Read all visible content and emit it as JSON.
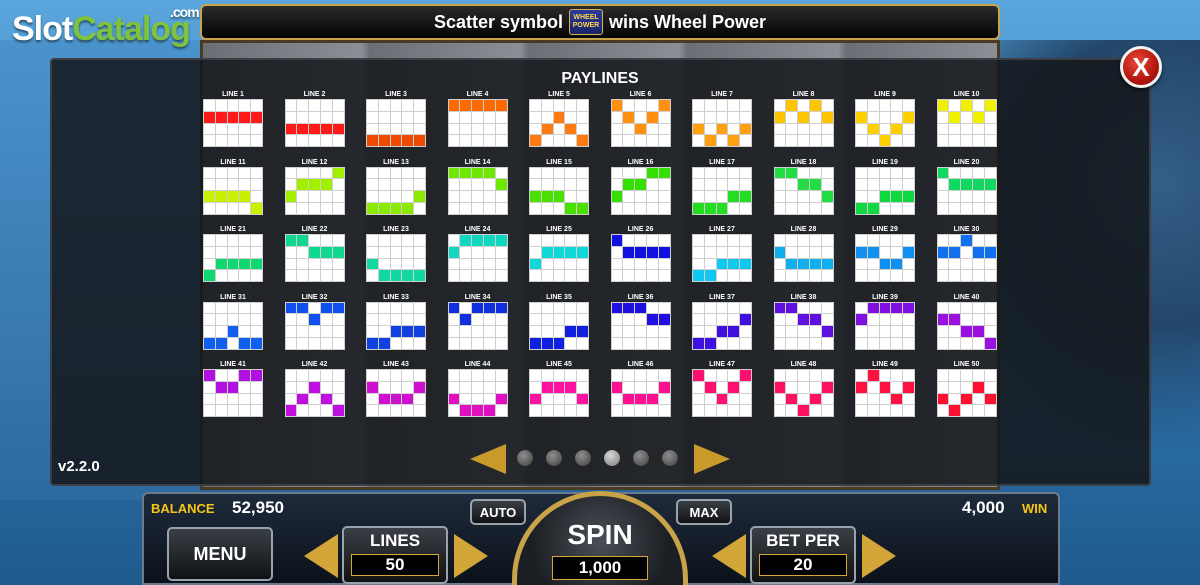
{
  "logo": {
    "slot": "Slot",
    "catalog": "Catalog",
    "com": ".com"
  },
  "topbar": {
    "before": "Scatter symbol",
    "after": "wins Wheel Power",
    "icon": "wheel-power-scatter-icon",
    "icon_text_1": "WHEEL",
    "icon_text_2": "POWER"
  },
  "paytable": {
    "title": "PAYLINES",
    "close": "X"
  },
  "version": "v2.2.0",
  "pagination": {
    "pages": 6,
    "active_index": 3
  },
  "console": {
    "balance_label": "BALANCE",
    "balance_value": "52,950",
    "win_value": "4,000",
    "win_label": "WIN",
    "menu_label": "MENU",
    "auto_label": "AUTO",
    "max_label": "MAX",
    "lines_label": "LINES",
    "lines_value": "50",
    "spin_label": "SPIN",
    "spin_value": "1,000",
    "betper_label": "BET PER",
    "betper_value": "20"
  },
  "paylines": [
    {
      "label": "LINE 1",
      "color": "#ff1a1a",
      "cells": [
        [
          0,
          1
        ],
        [
          1,
          1
        ],
        [
          2,
          1
        ],
        [
          3,
          1
        ],
        [
          4,
          1
        ]
      ]
    },
    {
      "label": "LINE 2",
      "color": "#ff1a1a",
      "cells": [
        [
          0,
          2
        ],
        [
          1,
          2
        ],
        [
          2,
          2
        ],
        [
          3,
          2
        ],
        [
          4,
          2
        ]
      ]
    },
    {
      "label": "LINE 3",
      "color": "#ee4a00",
      "cells": [
        [
          0,
          3
        ],
        [
          1,
          3
        ],
        [
          2,
          3
        ],
        [
          3,
          3
        ],
        [
          4,
          3
        ]
      ]
    },
    {
      "label": "LINE 4",
      "color": "#ff6a00",
      "cells": [
        [
          0,
          0
        ],
        [
          1,
          0
        ],
        [
          2,
          0
        ],
        [
          3,
          0
        ],
        [
          4,
          0
        ]
      ]
    },
    {
      "label": "LINE 5",
      "color": "#ff7a10",
      "cells": [
        [
          0,
          3
        ],
        [
          1,
          2
        ],
        [
          2,
          1
        ],
        [
          3,
          2
        ],
        [
          4,
          3
        ]
      ]
    },
    {
      "label": "LINE 6",
      "color": "#ff9010",
      "cells": [
        [
          0,
          0
        ],
        [
          1,
          1
        ],
        [
          2,
          2
        ],
        [
          3,
          1
        ],
        [
          4,
          0
        ]
      ]
    },
    {
      "label": "LINE 7",
      "color": "#ffa010",
      "cells": [
        [
          0,
          2
        ],
        [
          1,
          3
        ],
        [
          2,
          2
        ],
        [
          3,
          3
        ],
        [
          4,
          2
        ]
      ]
    },
    {
      "label": "LINE 8",
      "color": "#ffc400",
      "cells": [
        [
          0,
          1
        ],
        [
          1,
          0
        ],
        [
          2,
          1
        ],
        [
          3,
          0
        ],
        [
          4,
          1
        ]
      ]
    },
    {
      "label": "LINE 9",
      "color": "#ffd000",
      "cells": [
        [
          0,
          1
        ],
        [
          1,
          2
        ],
        [
          2,
          3
        ],
        [
          3,
          2
        ],
        [
          4,
          1
        ]
      ]
    },
    {
      "label": "LINE 10",
      "color": "#f0f000",
      "cells": [
        [
          0,
          0
        ],
        [
          1,
          1
        ],
        [
          2,
          0
        ],
        [
          3,
          1
        ],
        [
          4,
          0
        ]
      ]
    },
    {
      "label": "LINE 11",
      "color": "#c8f000",
      "cells": [
        [
          0,
          2
        ],
        [
          1,
          2
        ],
        [
          2,
          2
        ],
        [
          3,
          2
        ],
        [
          4,
          3
        ]
      ]
    },
    {
      "label": "LINE 12",
      "color": "#a0f000",
      "cells": [
        [
          0,
          2
        ],
        [
          1,
          1
        ],
        [
          2,
          1
        ],
        [
          3,
          1
        ],
        [
          4,
          0
        ]
      ]
    },
    {
      "label": "LINE 13",
      "color": "#8aea00",
      "cells": [
        [
          0,
          3
        ],
        [
          1,
          3
        ],
        [
          2,
          3
        ],
        [
          3,
          3
        ],
        [
          4,
          2
        ]
      ]
    },
    {
      "label": "LINE 14",
      "color": "#6ee800",
      "cells": [
        [
          0,
          0
        ],
        [
          1,
          0
        ],
        [
          2,
          0
        ],
        [
          3,
          0
        ],
        [
          4,
          1
        ]
      ]
    },
    {
      "label": "LINE 15",
      "color": "#4ae000",
      "cells": [
        [
          0,
          2
        ],
        [
          1,
          2
        ],
        [
          2,
          2
        ],
        [
          3,
          3
        ],
        [
          4,
          3
        ]
      ]
    },
    {
      "label": "LINE 16",
      "color": "#34e000",
      "cells": [
        [
          0,
          2
        ],
        [
          1,
          1
        ],
        [
          2,
          1
        ],
        [
          3,
          0
        ],
        [
          4,
          0
        ]
      ]
    },
    {
      "label": "LINE 17",
      "color": "#22dd22",
      "cells": [
        [
          0,
          3
        ],
        [
          1,
          3
        ],
        [
          2,
          3
        ],
        [
          3,
          2
        ],
        [
          4,
          2
        ]
      ]
    },
    {
      "label": "LINE 18",
      "color": "#22dd44",
      "cells": [
        [
          0,
          0
        ],
        [
          1,
          0
        ],
        [
          2,
          1
        ],
        [
          3,
          1
        ],
        [
          4,
          2
        ]
      ]
    },
    {
      "label": "LINE 19",
      "color": "#10d840",
      "cells": [
        [
          0,
          3
        ],
        [
          1,
          3
        ],
        [
          2,
          2
        ],
        [
          3,
          2
        ],
        [
          4,
          2
        ]
      ]
    },
    {
      "label": "LINE 20",
      "color": "#10d860",
      "cells": [
        [
          0,
          0
        ],
        [
          1,
          1
        ],
        [
          2,
          1
        ],
        [
          3,
          1
        ],
        [
          4,
          1
        ]
      ]
    },
    {
      "label": "LINE 21",
      "color": "#10d870",
      "cells": [
        [
          0,
          3
        ],
        [
          1,
          2
        ],
        [
          2,
          2
        ],
        [
          3,
          2
        ],
        [
          4,
          2
        ]
      ]
    },
    {
      "label": "LINE 22",
      "color": "#10d890",
      "cells": [
        [
          0,
          0
        ],
        [
          1,
          0
        ],
        [
          2,
          1
        ],
        [
          3,
          1
        ],
        [
          4,
          1
        ]
      ]
    },
    {
      "label": "LINE 23",
      "color": "#10d8a0",
      "cells": [
        [
          0,
          2
        ],
        [
          1,
          3
        ],
        [
          2,
          3
        ],
        [
          3,
          3
        ],
        [
          4,
          3
        ]
      ]
    },
    {
      "label": "LINE 24",
      "color": "#10d8c0",
      "cells": [
        [
          0,
          1
        ],
        [
          1,
          0
        ],
        [
          2,
          0
        ],
        [
          3,
          0
        ],
        [
          4,
          0
        ]
      ]
    },
    {
      "label": "LINE 25",
      "color": "#10d8d8",
      "cells": [
        [
          0,
          2
        ],
        [
          1,
          1
        ],
        [
          2,
          1
        ],
        [
          3,
          1
        ],
        [
          4,
          1
        ]
      ]
    },
    {
      "label": "LINE 26",
      "color": "#1010e0",
      "cells": [
        [
          0,
          0
        ],
        [
          1,
          1
        ],
        [
          2,
          1
        ],
        [
          3,
          1
        ],
        [
          4,
          1
        ]
      ]
    },
    {
      "label": "LINE 27",
      "color": "#10c8f0",
      "cells": [
        [
          0,
          3
        ],
        [
          1,
          3
        ],
        [
          2,
          2
        ],
        [
          3,
          2
        ],
        [
          4,
          2
        ]
      ]
    },
    {
      "label": "LINE 28",
      "color": "#10b0f0",
      "cells": [
        [
          0,
          1
        ],
        [
          1,
          2
        ],
        [
          2,
          2
        ],
        [
          3,
          2
        ],
        [
          4,
          2
        ]
      ]
    },
    {
      "label": "LINE 29",
      "color": "#1090f0",
      "cells": [
        [
          0,
          1
        ],
        [
          1,
          1
        ],
        [
          2,
          2
        ],
        [
          3,
          2
        ],
        [
          4,
          1
        ]
      ]
    },
    {
      "label": "LINE 30",
      "color": "#1070f0",
      "cells": [
        [
          0,
          1
        ],
        [
          1,
          1
        ],
        [
          2,
          0
        ],
        [
          3,
          1
        ],
        [
          4,
          1
        ]
      ]
    },
    {
      "label": "LINE 31",
      "color": "#1060f0",
      "cells": [
        [
          0,
          3
        ],
        [
          1,
          3
        ],
        [
          2,
          2
        ],
        [
          3,
          3
        ],
        [
          4,
          3
        ]
      ]
    },
    {
      "label": "LINE 32",
      "color": "#1050f0",
      "cells": [
        [
          0,
          0
        ],
        [
          1,
          0
        ],
        [
          2,
          1
        ],
        [
          3,
          0
        ],
        [
          4,
          0
        ]
      ]
    },
    {
      "label": "LINE 33",
      "color": "#1040e0",
      "cells": [
        [
          0,
          3
        ],
        [
          1,
          3
        ],
        [
          2,
          2
        ],
        [
          3,
          2
        ],
        [
          4,
          2
        ]
      ]
    },
    {
      "label": "LINE 34",
      "color": "#1030e0",
      "cells": [
        [
          0,
          0
        ],
        [
          1,
          1
        ],
        [
          2,
          0
        ],
        [
          3,
          0
        ],
        [
          4,
          0
        ]
      ]
    },
    {
      "label": "LINE 35",
      "color": "#1020e0",
      "cells": [
        [
          0,
          3
        ],
        [
          1,
          3
        ],
        [
          2,
          3
        ],
        [
          3,
          2
        ],
        [
          4,
          2
        ]
      ]
    },
    {
      "label": "LINE 36",
      "color": "#2010e0",
      "cells": [
        [
          0,
          0
        ],
        [
          1,
          0
        ],
        [
          2,
          0
        ],
        [
          3,
          1
        ],
        [
          4,
          1
        ]
      ]
    },
    {
      "label": "LINE 37",
      "color": "#4010e0",
      "cells": [
        [
          0,
          3
        ],
        [
          1,
          3
        ],
        [
          2,
          2
        ],
        [
          3,
          2
        ],
        [
          4,
          1
        ]
      ]
    },
    {
      "label": "LINE 38",
      "color": "#6010e0",
      "cells": [
        [
          0,
          0
        ],
        [
          1,
          0
        ],
        [
          2,
          1
        ],
        [
          3,
          1
        ],
        [
          4,
          2
        ]
      ]
    },
    {
      "label": "LINE 39",
      "color": "#8010e0",
      "cells": [
        [
          0,
          1
        ],
        [
          1,
          0
        ],
        [
          2,
          0
        ],
        [
          3,
          0
        ],
        [
          4,
          0
        ]
      ]
    },
    {
      "label": "LINE 40",
      "color": "#9a10e0",
      "cells": [
        [
          0,
          1
        ],
        [
          1,
          1
        ],
        [
          2,
          2
        ],
        [
          3,
          2
        ],
        [
          4,
          3
        ]
      ]
    },
    {
      "label": "LINE 41",
      "color": "#b010e0",
      "cells": [
        [
          0,
          0
        ],
        [
          1,
          1
        ],
        [
          2,
          1
        ],
        [
          3,
          0
        ],
        [
          4,
          0
        ]
      ]
    },
    {
      "label": "LINE 42",
      "color": "#c010e0",
      "cells": [
        [
          0,
          3
        ],
        [
          1,
          2
        ],
        [
          2,
          1
        ],
        [
          3,
          2
        ],
        [
          4,
          3
        ]
      ]
    },
    {
      "label": "LINE 43",
      "color": "#d010d0",
      "cells": [
        [
          0,
          1
        ],
        [
          1,
          2
        ],
        [
          2,
          2
        ],
        [
          3,
          2
        ],
        [
          4,
          1
        ]
      ]
    },
    {
      "label": "LINE 44",
      "color": "#e010c0",
      "cells": [
        [
          0,
          2
        ],
        [
          1,
          3
        ],
        [
          2,
          3
        ],
        [
          3,
          3
        ],
        [
          4,
          2
        ]
      ]
    },
    {
      "label": "LINE 45",
      "color": "#ff10a0",
      "cells": [
        [
          0,
          2
        ],
        [
          1,
          1
        ],
        [
          2,
          1
        ],
        [
          3,
          1
        ],
        [
          4,
          2
        ]
      ]
    },
    {
      "label": "LINE 46",
      "color": "#ff1090",
      "cells": [
        [
          0,
          1
        ],
        [
          1,
          2
        ],
        [
          2,
          2
        ],
        [
          3,
          2
        ],
        [
          4,
          1
        ]
      ]
    },
    {
      "label": "LINE 47",
      "color": "#ff1070",
      "cells": [
        [
          0,
          0
        ],
        [
          1,
          1
        ],
        [
          2,
          2
        ],
        [
          3,
          1
        ],
        [
          4,
          0
        ]
      ]
    },
    {
      "label": "LINE 48",
      "color": "#ff1060",
      "cells": [
        [
          0,
          1
        ],
        [
          1,
          2
        ],
        [
          2,
          3
        ],
        [
          3,
          2
        ],
        [
          4,
          1
        ]
      ]
    },
    {
      "label": "LINE 49",
      "color": "#ff1040",
      "cells": [
        [
          0,
          1
        ],
        [
          1,
          0
        ],
        [
          2,
          1
        ],
        [
          3,
          2
        ],
        [
          4,
          1
        ]
      ]
    },
    {
      "label": "LINE 50",
      "color": "#ff1030",
      "cells": [
        [
          0,
          2
        ],
        [
          1,
          3
        ],
        [
          2,
          2
        ],
        [
          3,
          1
        ],
        [
          4,
          2
        ]
      ]
    }
  ]
}
